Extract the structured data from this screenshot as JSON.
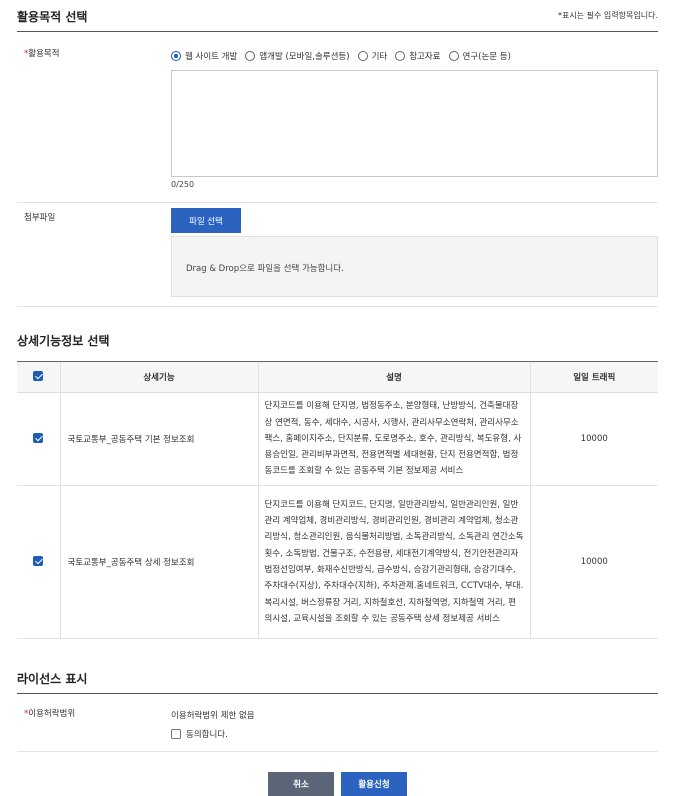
{
  "purpose_section": {
    "title": "활용목적 선택",
    "required_note": "*표시는 필수 입력항목입니다.",
    "purpose_label": "활용목적",
    "options": [
      {
        "label": "웹 사이트 개발",
        "selected": true
      },
      {
        "label": "앱개발 (모바일,솔루션등)",
        "selected": false
      },
      {
        "label": "기타",
        "selected": false
      },
      {
        "label": "참고자료",
        "selected": false
      },
      {
        "label": "연구(논문 등)",
        "selected": false
      }
    ],
    "textarea_value": "",
    "char_counter": "0/250",
    "attachment_label": "첨부파일",
    "file_button": "파일 선택",
    "drop_hint": "Drag & Drop으로 파일을 선택 가능합니다."
  },
  "detail_section": {
    "title": "상세기능정보 선택",
    "headers": {
      "feature": "상세기능",
      "description": "설명",
      "traffic": "일일 트래픽"
    },
    "header_checked": true,
    "rows": [
      {
        "checked": true,
        "feature": "국토교통부_공동주택 기본 정보조회",
        "description": "단지코드를 이용해 단지명, 법정동주소, 분양형태, 난방방식, 건축물대장상 연면적, 동수, 세대수, 시공사, 시행사, 관리사무소연락처, 관리사무소팩스, 홈페이지주소, 단지분류, 도로명주소, 호수, 관리방식, 복도유형, 사용승인일, 관리비부과면적, 전용면적별 세대현황, 단지 전용면적합, 법정동코드를 조회할 수 있는 공동주택 기본 정보제공 서비스",
        "traffic": "10000"
      },
      {
        "checked": true,
        "feature": "국토교통부_공동주택 상세 정보조회",
        "description": "단지코드를 이용해 단지코드, 단지명, 일반관리방식, 일반관리인원, 일반관리 계약업체, 경비관리방식, 경비관리인원, 경비관리 계약업체, 청소관리방식, 청소관리인원, 음식물처리방법, 소독관리방식, 소독관리 연간소독횟수, 소독방법, 건물구조, 수전용량, 세대전기계약방식, 전기안전관리자법정선임여부, 화재수신반방식, 급수방식, 승강기관리형태, 승강기대수, 주차대수(지상), 주차대수(지하), 주차관제.홈네트워크, CCTV대수, 부대.복리시설, 버스정류장 거리, 지하철호선, 지하철역명, 지하철역 거리, 편의시설, 교육시설을 조회할 수 있는 공동주택 상세 정보제공 서비스",
        "traffic": "10000"
      }
    ]
  },
  "license_section": {
    "title": "라이선스 표시",
    "scope_label": "이용허락범위",
    "scope_value": "이용허락범위 제한 없음",
    "agree_label": "동의합니다.",
    "agree_checked": false
  },
  "actions": {
    "cancel": "취소",
    "apply": "활용신청"
  },
  "colors": {
    "accent": "#2d63c0",
    "cancel": "#5a6577",
    "required": "#dd2222"
  }
}
